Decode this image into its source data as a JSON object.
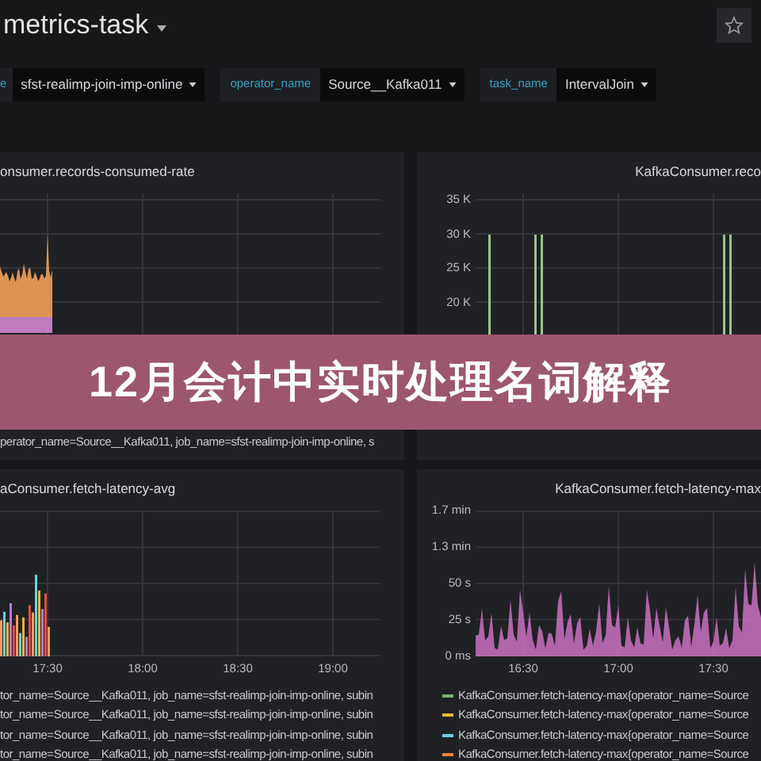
{
  "header": {
    "title": "metrics-task"
  },
  "variables": [
    {
      "label": "e",
      "value": "sfst-realimp-join-imp-online"
    },
    {
      "label": "operator_name",
      "value": "Source__Kafka011"
    },
    {
      "label": "task_name",
      "value": "IntervalJoin"
    }
  ],
  "panels": [
    {
      "title": "onsumer.records-consumed-rate",
      "kind": "area",
      "legend": [
        {
          "text": "perator_name=Source__Kafka011, job_name=sfst-realimp-join-imp-online, s"
        }
      ]
    },
    {
      "title": "KafkaConsumer.reco",
      "kind": "spikes",
      "y_ticks": [
        "35 K",
        "30 K",
        "25 K",
        "20 K"
      ]
    },
    {
      "title": "aConsumer.fetch-latency-avg",
      "kind": "bars",
      "x_ticks": [
        "17:30",
        "18:00",
        "18:30",
        "19:00"
      ],
      "legend": [
        {
          "text": "tor_name=Source__Kafka011, job_name=sfst-realimp-join-imp-online, subin"
        },
        {
          "text": "tor_name=Source__Kafka011, job_name=sfst-realimp-join-imp-online, subin"
        },
        {
          "text": "tor_name=Source__Kafka011, job_name=sfst-realimp-join-imp-online, subin"
        },
        {
          "text": "tor_name=Source__Kafka011, job_name=sfst-realimp-join-imp-online, subin"
        }
      ]
    },
    {
      "title": "KafkaConsumer.fetch-latency-max",
      "kind": "dense",
      "y_ticks": [
        "1.7 min",
        "1.3 min",
        "50 s",
        "25 s",
        "0 ms"
      ],
      "x_ticks": [
        "16:30",
        "17:00",
        "17:30"
      ],
      "legend": [
        {
          "text": "KafkaConsumer.fetch-latency-max{operator_name=Source",
          "color": "#7eb26d"
        },
        {
          "text": "KafkaConsumer.fetch-latency-max{operator_name=Source",
          "color": "#eab839"
        },
        {
          "text": "KafkaConsumer.fetch-latency-max{operator_name=Source",
          "color": "#6ed0e0"
        },
        {
          "text": "KafkaConsumer.fetch-latency-max{operator_name=Source",
          "color": "#ef843c"
        }
      ]
    }
  ],
  "banner": {
    "text": "12月会计中实时处理名词解释"
  }
}
